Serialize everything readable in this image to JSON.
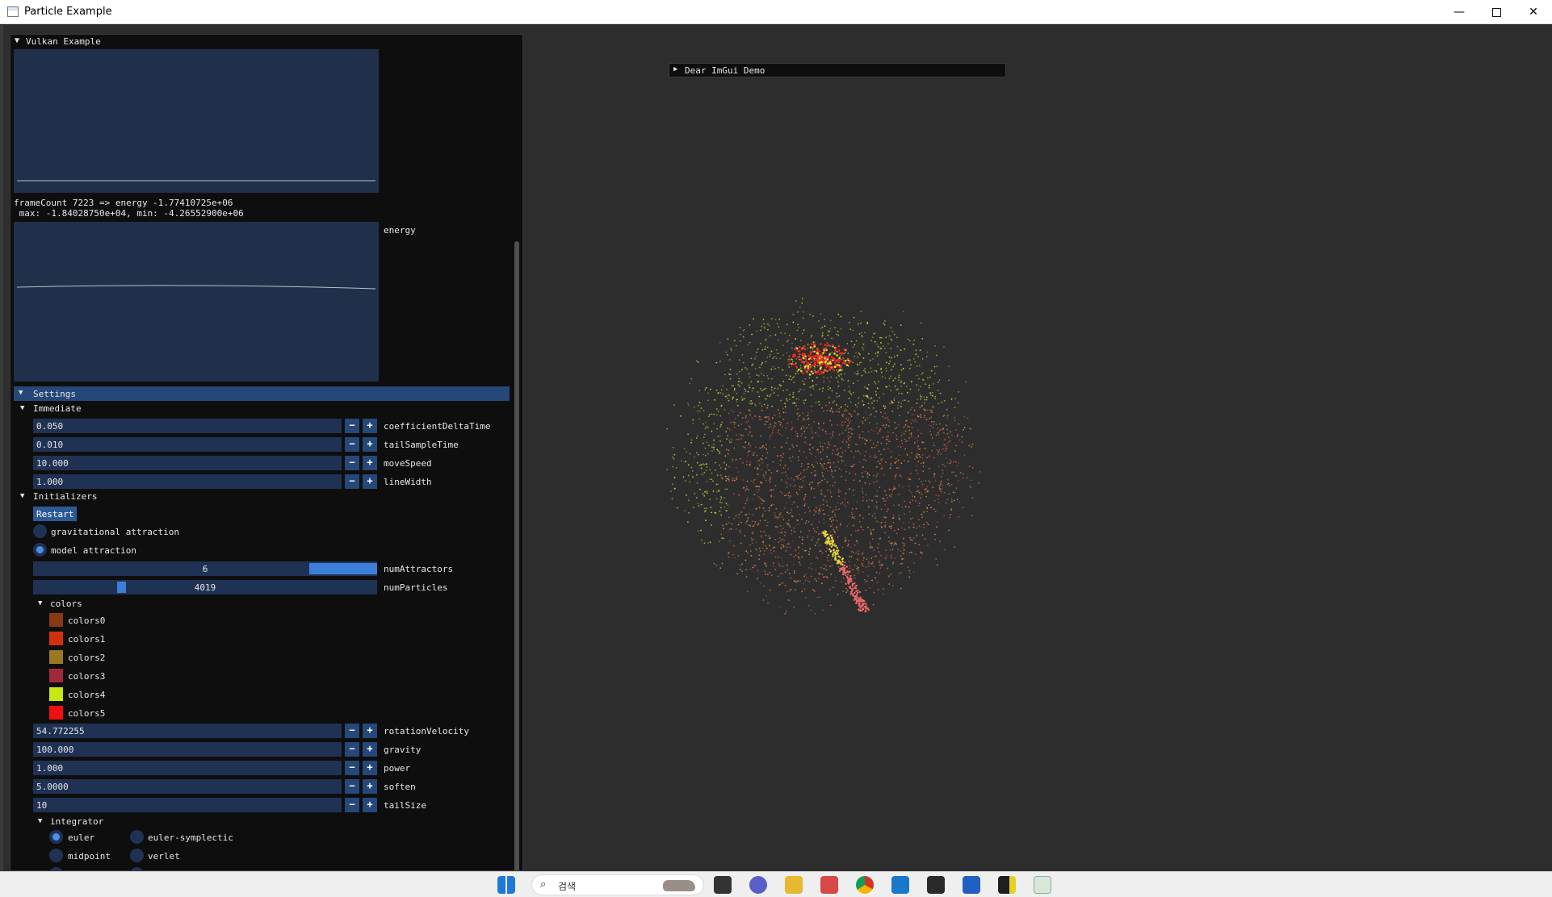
{
  "window": {
    "title": "Particle Example",
    "minimize": "—",
    "close": "✕"
  },
  "vulkan_window": {
    "title": "Vulkan Example",
    "frame_text": "frameCount 7223 => energy -1.77410725e+06",
    "range_text": " max: -1.84028750e+04, min: -4.26552900e+06",
    "energy_label": "energy"
  },
  "settings": {
    "title": "Settings",
    "immediate": {
      "title": "Immediate",
      "fields": [
        {
          "value": "0.050",
          "label": "coefficientDeltaTime"
        },
        {
          "value": "0.010",
          "label": "tailSampleTime"
        },
        {
          "value": "10.000",
          "label": "moveSpeed"
        },
        {
          "value": "1.000",
          "label": "lineWidth"
        }
      ]
    },
    "initializers": {
      "title": "Initializers",
      "restart_label": "Restart",
      "options": [
        {
          "label": "gravitational attraction",
          "selected": false
        },
        {
          "label": "model attraction",
          "selected": true
        }
      ],
      "sliders": [
        {
          "value": "6",
          "label": "numAttractors",
          "fraction": 0.81
        },
        {
          "value": "4019",
          "label": "numParticles",
          "fraction": 0.23
        }
      ],
      "colors": {
        "title": "colors",
        "items": [
          {
            "label": "colors0",
            "color": "#8a3a10"
          },
          {
            "label": "colors1",
            "color": "#d03010"
          },
          {
            "label": "colors2",
            "color": "#9a7a20"
          },
          {
            "label": "colors3",
            "color": "#a02a38"
          },
          {
            "label": "colors4",
            "color": "#c8e810"
          },
          {
            "label": "colors5",
            "color": "#f01010"
          }
        ]
      }
    },
    "params": [
      {
        "value": "54.772255",
        "label": "rotationVelocity"
      },
      {
        "value": "100.000",
        "label": "gravity"
      },
      {
        "value": "1.000",
        "label": "power"
      },
      {
        "value": "5.0000",
        "label": "soften"
      },
      {
        "value": "10",
        "label": "tailSize"
      }
    ],
    "integrator": {
      "title": "integrator",
      "options": [
        {
          "label": "euler",
          "selected": true
        },
        {
          "label": "euler-symplectic",
          "selected": false
        },
        {
          "label": "midpoint",
          "selected": false
        },
        {
          "label": "verlet",
          "selected": false
        }
      ]
    }
  },
  "demo_window": {
    "title": "Dear ImGui Demo"
  },
  "taskbar": {
    "search_placeholder": "검색"
  },
  "colors": {
    "accent": "#254878",
    "frame_bg": "#203254",
    "slider_grab": "#3c7fd9",
    "window_bg": "#0e0e0e"
  }
}
